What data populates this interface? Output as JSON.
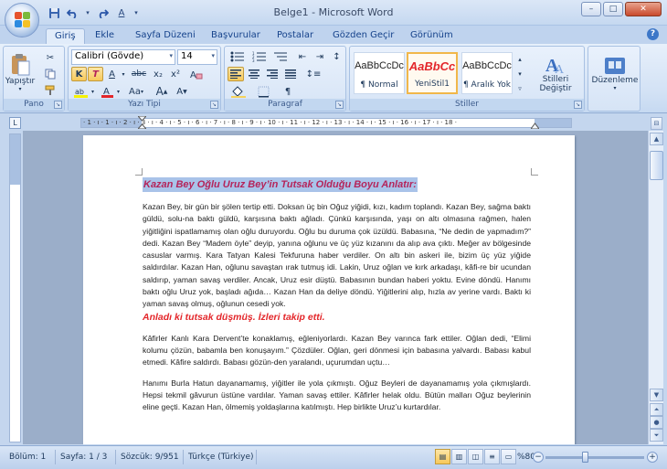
{
  "window": {
    "title": "Belge1 - Microsoft Word"
  },
  "qat": {
    "save_icon": "save-icon",
    "undo_icon": "undo-icon",
    "redo_icon": "redo-icon"
  },
  "tabs": [
    "Giriş",
    "Ekle",
    "Sayfa Düzeni",
    "Başvurular",
    "Postalar",
    "Gözden Geçir",
    "Görünüm"
  ],
  "ribbon": {
    "clipboard": {
      "paste_label": "Yapıştır",
      "group_label": "Pano"
    },
    "font": {
      "font_name": "Calibri (Gövde)",
      "font_size": "14",
      "group_label": "Yazı Tipi",
      "bold": "K",
      "italic": "T",
      "underline": "A",
      "strike": "abc",
      "subscript": "x₂",
      "superscript": "x²",
      "change_case": "Aa",
      "grow": "A",
      "shrink": "A"
    },
    "paragraph": {
      "group_label": "Paragraf"
    },
    "styles": {
      "group_label": "Stiller",
      "items": [
        {
          "sample": "AaBbCcDc",
          "name": "¶ Normal"
        },
        {
          "sample": "AaBbCc",
          "name": "YeniStil1"
        },
        {
          "sample": "AaBbCcDc",
          "name": "¶ Aralık Yok"
        }
      ],
      "change_styles_label": "Stilleri Değiştir"
    },
    "editing": {
      "label": "Düzenleme"
    }
  },
  "ruler": {
    "ticks": "· 1 · ı · 1 · ı · 2 · ı · 3 · ı · 4 · ı · 5 · ı · 6 · ı · 7 · ı · 8 · ı · 9 · ı · 10 · ı · 11 · ı · 12 · ı · 13 · ı · 14 · ı · 15 · ı · 16 · ı · 17 · ı · 18 ·"
  },
  "document": {
    "heading": "Kazan Bey Oğlu Uruz Bey’in Tutsak Olduğu Boyu Anlatır:",
    "para1": "Kazan Bey, bir gün bir şölen tertip etti. Doksan üç bin Oğuz yiğidi, kızı, kadım toplandı. Kazan Bey, sağma baktı güldü, solu-na baktı güldü, karşısına baktı ağladı. Çünkü karşısında, yaşı on altı olmasına rağmen, halen yiğitliğini ispatlamamış olan oğlu duruyordu. Oğlu bu duruma çok üzüldü. Babasına, “Ne dedin de yapmadım?” dedi. Kazan Bey “Madem öyle” deyip, yanına oğlunu ve üç yüz kızanını da alıp ava çıktı. Meğer av bölgesinde casuslar varmış. Kara Tatyan Kalesi Tekfuruna haber verdiler. On altı bin askeri ile, bizim üç yüz yiğide saldırdılar. Kazan Han, oğlunu savaştan ırak tutmuş idi. Lakin, Uruz oğlan ve kırk arkadaşı, kâfi-re bir ucundan saldırıp, yaman savaş verdiler. Ancak, Uruz esir düştü. Babasının bundan haberi yoktu. Evine döndü. Hanımı baktı oğlu Uruz yok, başladı ağıda… Kazan Han da deliye döndü. Yiğitlerini alıp, hızla av yerine vardı. Baktı ki yaman savaş olmuş, oğlunun cesedi yok.",
    "red_line": "Anladı ki tutsak düşmüş. İzleri takip etti.",
    "para2": "Kâfirler Kanlı Kara Dervent’te konaklamış, eğleniyorlardı. Kazan Bey varınca fark ettiler. Oğlan dedi, “Elimi kolumu çözün, babamla ben konuşayım.” Çözdüler. Oğlan, geri dönmesi için babasına yalvardı. Babası kabul etmedi. Kâfire saldırdı. Babası gözün-den yaralandı, uçurumdan uçtu…",
    "para3": "Hanımı Burla Hatun dayanamamış, yiğitler ile yola çıkmıştı. Oğuz Beyleri de dayanamamış yola çıkmışlardı. Hepsi tekmil gâvurun üstüne vardılar. Yaman savaş ettiler. Kâfirler helak oldu. Bütün malları Oğuz beylerinin eline geçti. Kazan Han, ölmemiş yoldaşlarına katılmıştı. Hep birlikte Uruz’u kurtardılar."
  },
  "status": {
    "section": "Bölüm: 1",
    "page": "Sayfa: 1 / 3",
    "words": "Sözcük: 9/951",
    "language": "Türkçe (Türkiye)",
    "zoom": "%80"
  }
}
